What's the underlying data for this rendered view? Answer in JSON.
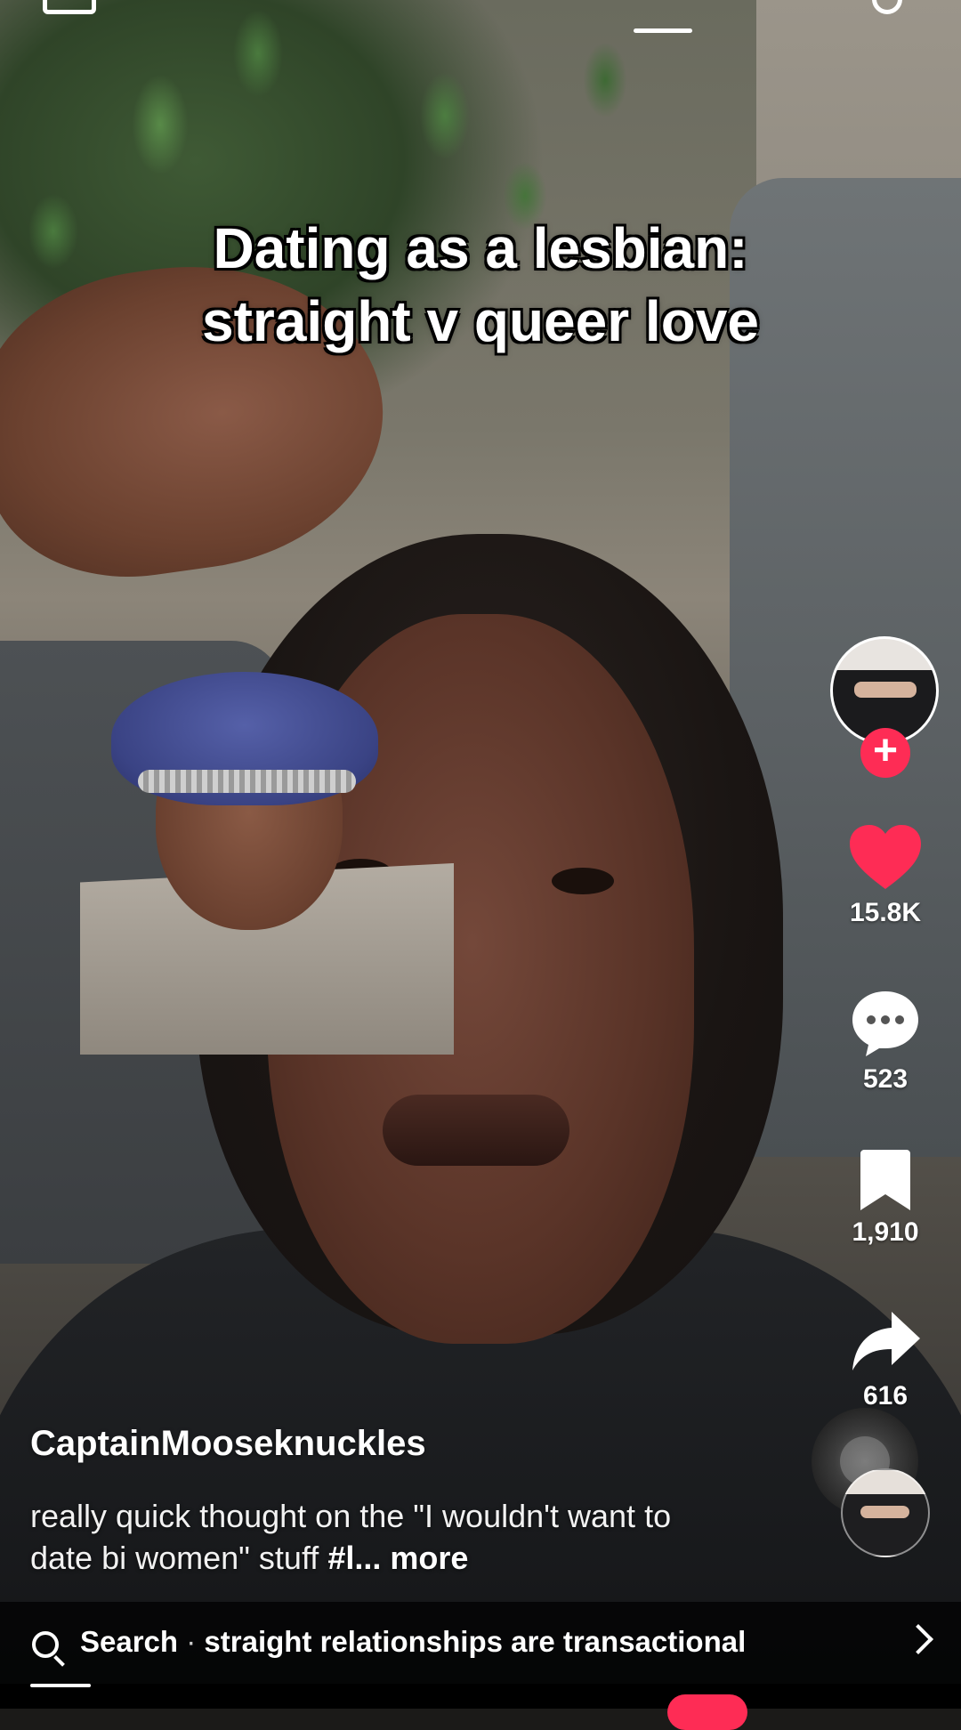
{
  "video": {
    "caption_line1": "Dating as a lesbian:",
    "caption_line2": "straight v queer love"
  },
  "actions": {
    "likes": "15.8K",
    "comments": "523",
    "saves": "1,910",
    "shares": "616"
  },
  "post": {
    "username": "CaptainMooseknuckles",
    "description": "really quick thought on the \"I wouldn't want to date bi women\" stuff ",
    "hashtag": "#l",
    "ellipsis": "...",
    "more": " more"
  },
  "search_suggestion": {
    "label": "Search",
    "separator": " · ",
    "query": "straight relationships are transactional"
  },
  "colors": {
    "accent": "#fe2c55",
    "like": "#fe2c55"
  },
  "icons": {
    "top_left": "inbox-icon",
    "top_right": "search-icon",
    "like": "heart-icon",
    "comment": "comment-icon",
    "save": "bookmark-icon",
    "share": "share-icon",
    "search_bar": "search-icon",
    "chevron": "chevron-right-icon"
  }
}
